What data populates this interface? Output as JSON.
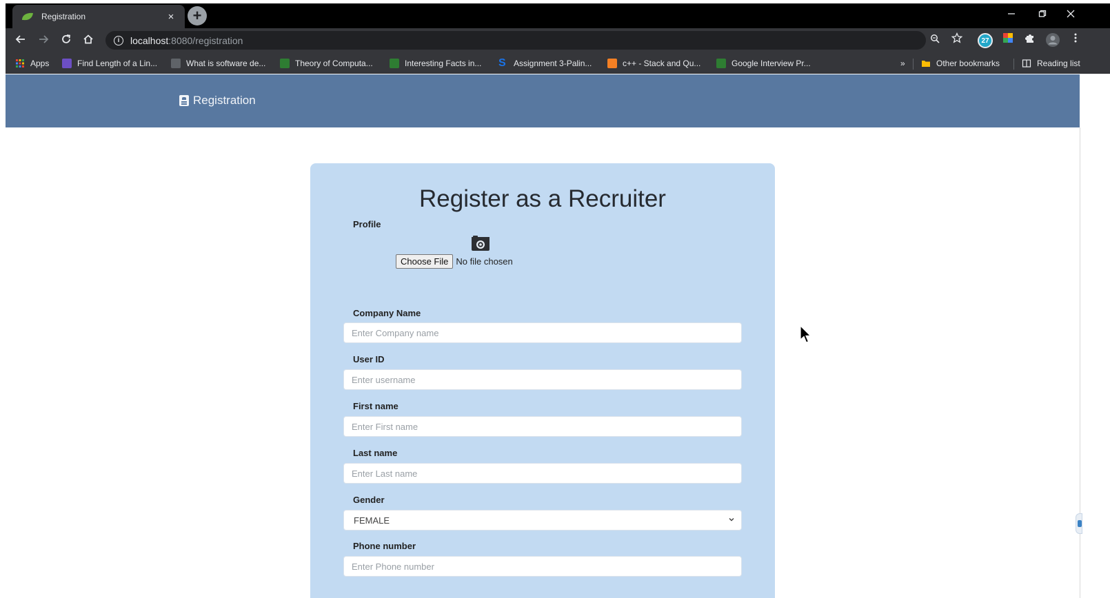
{
  "browser": {
    "tab_title": "Registration",
    "tab_close": "×",
    "new_tab": "+",
    "url_host": "localhost",
    "url_rest": ":8080/registration",
    "extension_badge": "27",
    "bookmarks": [
      {
        "label": "Apps",
        "color": "#e37400"
      },
      {
        "label": "Find Length of a Lin...",
        "color": "#6c4fc4"
      },
      {
        "label": "What is software de...",
        "color": "#5f6368"
      },
      {
        "label": "Theory of Computa...",
        "color": "#2e7d32"
      },
      {
        "label": "Interesting Facts in...",
        "color": "#2e7d32"
      },
      {
        "label": "Assignment 3-Palin...",
        "color": "#1a73e8"
      },
      {
        "label": "c++ - Stack and Qu...",
        "color": "#f48024"
      },
      {
        "label": "Google Interview Pr...",
        "color": "#2e7d32"
      }
    ],
    "more_bookmarks": "»",
    "other_bookmarks": "Other bookmarks",
    "reading_list": "Reading list"
  },
  "app": {
    "brand": "Registration",
    "colors": {
      "appbar": "#5878a0",
      "card": "#c2daf2"
    }
  },
  "form": {
    "title": "Register as a Recruiter",
    "profile_label": "Profile",
    "camera_icon": "camera-icon",
    "choose_file": "Choose File",
    "file_status": "No file chosen",
    "company": {
      "label": "Company Name",
      "placeholder": "Enter Company name",
      "value": ""
    },
    "user_id": {
      "label": "User ID",
      "placeholder": "Enter username",
      "value": ""
    },
    "first_name": {
      "label": "First name",
      "placeholder": "Enter First name",
      "value": ""
    },
    "last_name": {
      "label": "Last name",
      "placeholder": "Enter Last name",
      "value": ""
    },
    "gender": {
      "label": "Gender",
      "value": "FEMALE"
    },
    "phone": {
      "label": "Phone number",
      "placeholder": "Enter Phone number",
      "value": ""
    }
  }
}
